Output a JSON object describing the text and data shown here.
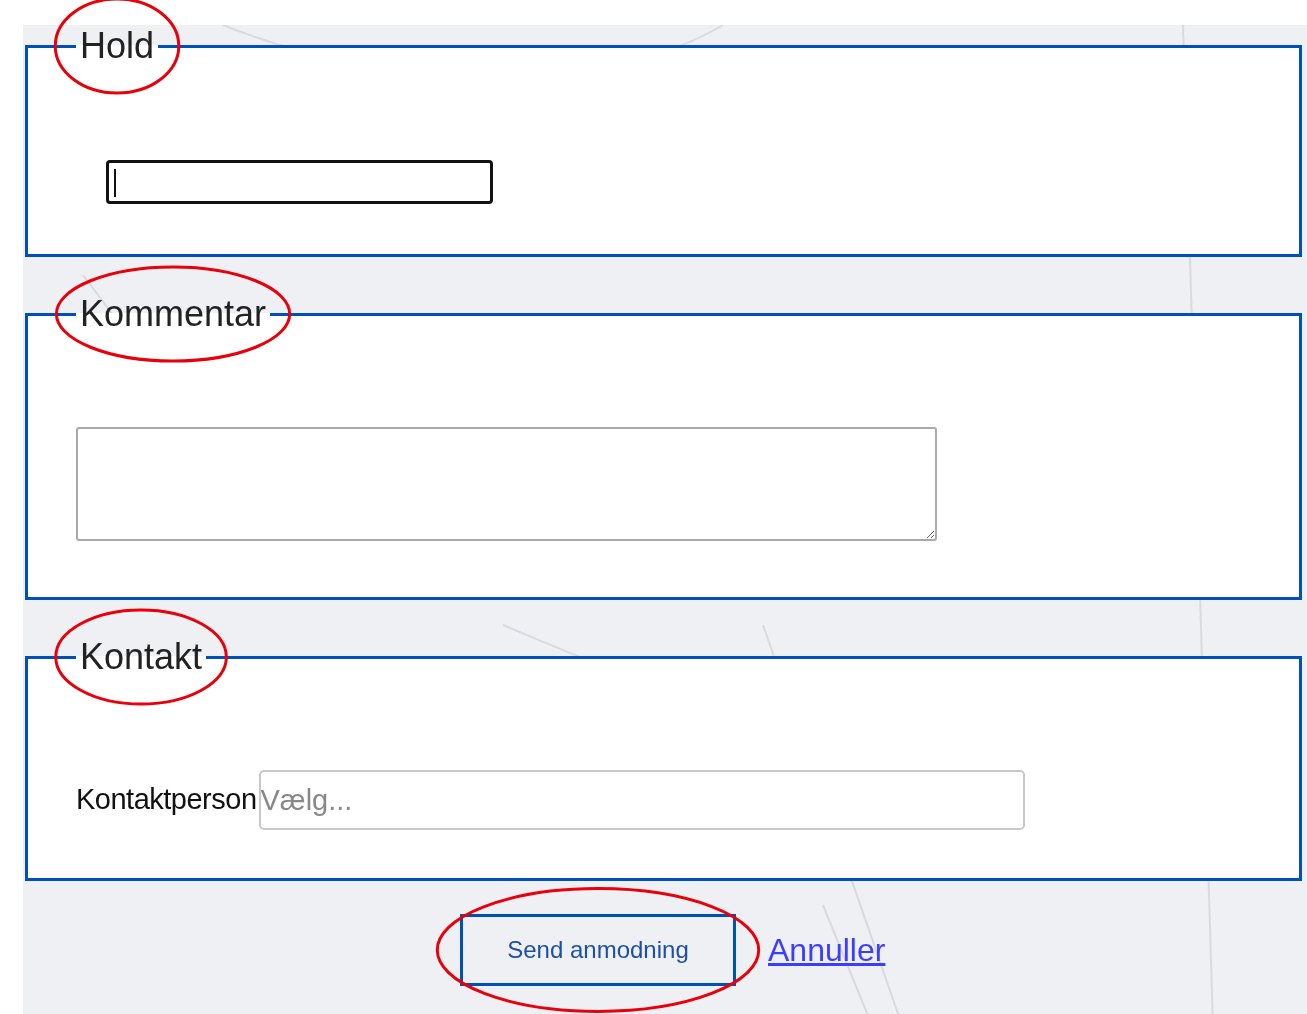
{
  "sections": [
    {
      "legend": "Hold",
      "highlighted": true,
      "kind": "text_input",
      "focused": true
    },
    {
      "legend": "Kommentar",
      "highlighted": true,
      "kind": "textarea"
    },
    {
      "legend": "Kontakt",
      "highlighted": true,
      "kind": "select",
      "label": "Kontaktperson",
      "placeholder": "Vælg..."
    }
  ],
  "actions": {
    "submit": {
      "label": "Send anmodning",
      "highlighted": true
    },
    "cancel": {
      "label": "Annuller"
    }
  }
}
